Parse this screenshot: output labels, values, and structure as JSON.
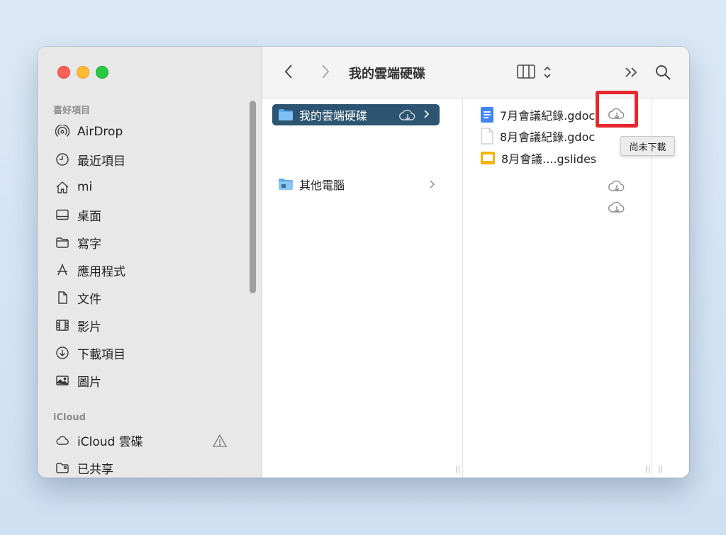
{
  "window": {
    "title": "我的雲端硬碟"
  },
  "sidebar": {
    "favorites_title": "喜好項目",
    "favorites": [
      {
        "label": "AirDrop",
        "icon": "airdrop-icon"
      },
      {
        "label": "最近項目",
        "icon": "clock-icon"
      },
      {
        "label": "mi",
        "icon": "home-icon"
      },
      {
        "label": "桌面",
        "icon": "desktop-icon"
      },
      {
        "label": "寫字",
        "icon": "folder-icon"
      },
      {
        "label": "應用程式",
        "icon": "applications-icon"
      },
      {
        "label": "文件",
        "icon": "document-icon"
      },
      {
        "label": "影片",
        "icon": "film-icon"
      },
      {
        "label": "下載項目",
        "icon": "download-icon"
      },
      {
        "label": "圖片",
        "icon": "photo-icon"
      }
    ],
    "icloud_title": "iCloud",
    "icloud": [
      {
        "label": "iCloud 雲碟",
        "icon": "cloud-icon"
      },
      {
        "label": "已共享",
        "icon": "shared-folder-icon"
      }
    ]
  },
  "column1": [
    {
      "label": "我的雲端硬碟",
      "selected": true
    },
    {
      "label": "其他電腦",
      "selected": false
    }
  ],
  "column2": [
    {
      "label": "7月會議紀錄.gdoc",
      "icon": "google-doc-icon"
    },
    {
      "label": "8月會議紀錄.gdoc",
      "icon": "blank-document-icon"
    },
    {
      "label": "8月會議....gslides",
      "icon": "google-slides-icon"
    }
  ],
  "tooltip": "尚未下載",
  "colors": {
    "selection": "#2d5571",
    "highlight": "#e8262f",
    "folder": "#5ea8e8",
    "gdoc": "#4285f4",
    "gslides": "#f4b400"
  }
}
